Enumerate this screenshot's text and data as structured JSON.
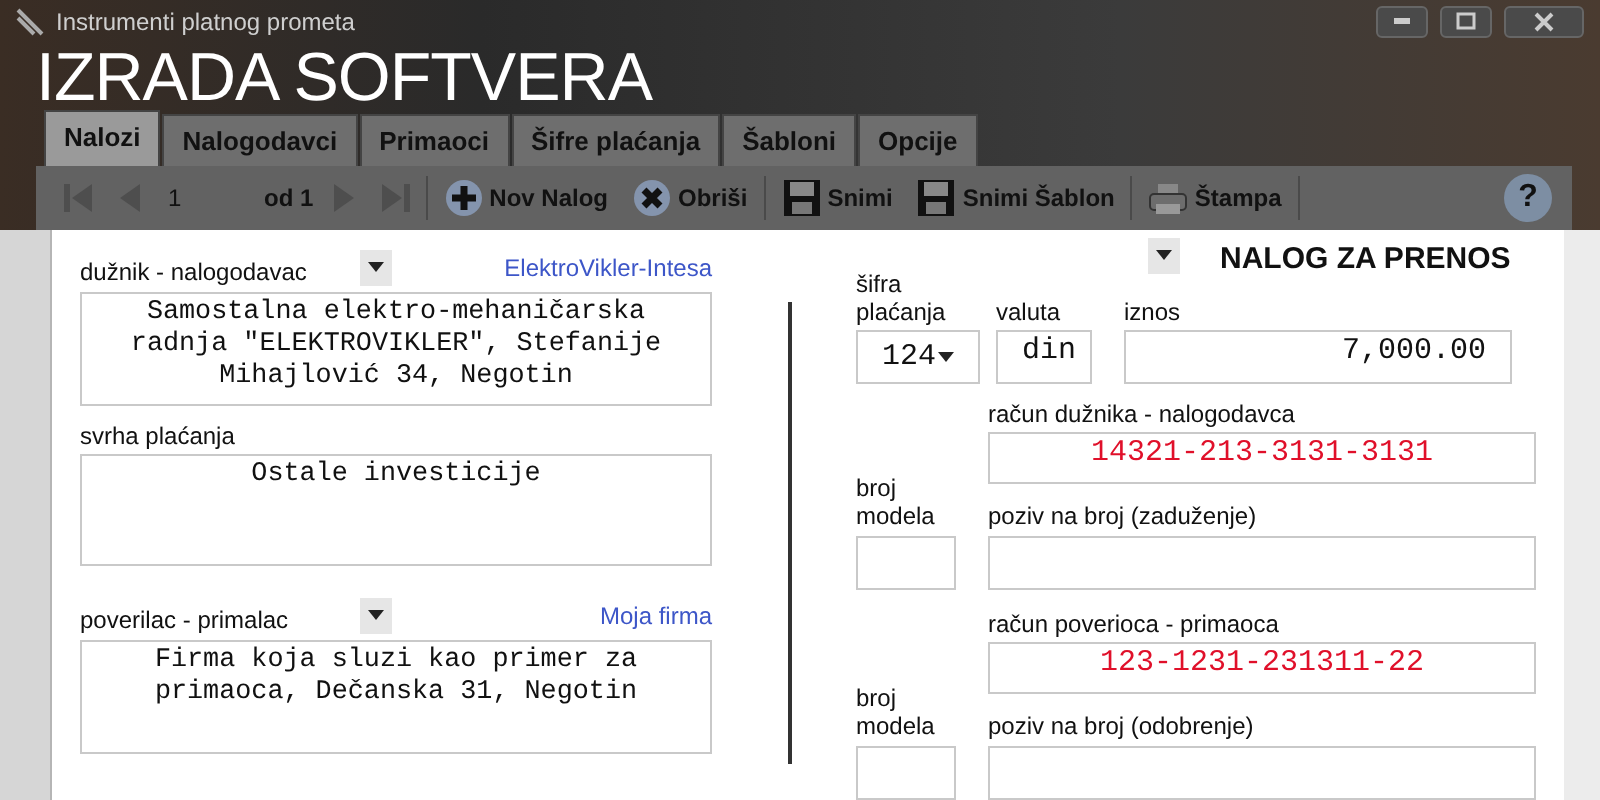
{
  "window": {
    "title": "Instrumenti platnog prometa"
  },
  "banner": {
    "title": "IZRADA SOFTVERA"
  },
  "tabs": [
    {
      "label": "Nalozi",
      "selected": true
    },
    {
      "label": "Nalogodavci",
      "selected": false
    },
    {
      "label": "Primaoci",
      "selected": false
    },
    {
      "label": "Šifre plaćanja",
      "selected": false
    },
    {
      "label": "Šabloni",
      "selected": false
    },
    {
      "label": "Opcije",
      "selected": false
    }
  ],
  "toolbar": {
    "nav_before": [
      {
        "kind": "first",
        "disabled": true
      },
      {
        "kind": "prev",
        "disabled": true
      }
    ],
    "page": "1",
    "page_count": "od 1",
    "nav_after": [
      {
        "kind": "next",
        "disabled": true
      },
      {
        "kind": "last",
        "disabled": true
      }
    ],
    "actions": [
      {
        "kind": "add",
        "label": "Nov Nalog"
      },
      {
        "kind": "delete",
        "label": "Obriši"
      },
      {
        "kind": "save",
        "label": "Snimi"
      },
      {
        "kind": "save",
        "label": "Snimi Šablon"
      },
      {
        "kind": "print",
        "label": "Štampa"
      }
    ],
    "help": "?"
  },
  "form": {
    "debtor": {
      "label": "dužnik - nalogodavac",
      "link": "ElektroVikler-Intesa",
      "text": "Samostalna elektro-mehaničarska radnja \"ELEKTROVIKLER\", Stefanije Mihajlović 34, Negotin"
    },
    "purpose": {
      "label": "svrha plaćanja",
      "text": "Ostale investicije"
    },
    "creditor": {
      "label": "poverilac - primalac",
      "link": "Moja firma",
      "text": "Firma koja sluzi kao primer za primaoca, Dečanska 31, Negotin"
    },
    "heading": "NALOG ZA PRENOS",
    "payment_code": {
      "label": "šifra plaćanja",
      "value": "124"
    },
    "currency": {
      "label": "valuta",
      "value": "din"
    },
    "amount": {
      "label": "iznos",
      "value": "7,000.00"
    },
    "debtor_account": {
      "label": "račun dužnika - nalogodavca",
      "value": "14321-213-3131-3131"
    },
    "debtor_model": {
      "label": "broj modela"
    },
    "debtor_reference": {
      "label": "poziv na broj (zaduženje)"
    },
    "creditor_account": {
      "label": "račun poverioca - primaoca",
      "value": "123-1231-231311-22"
    },
    "creditor_model": {
      "label": "broj modela"
    },
    "creditor_reference": {
      "label": "poziv na broj (odobrenje)"
    }
  }
}
